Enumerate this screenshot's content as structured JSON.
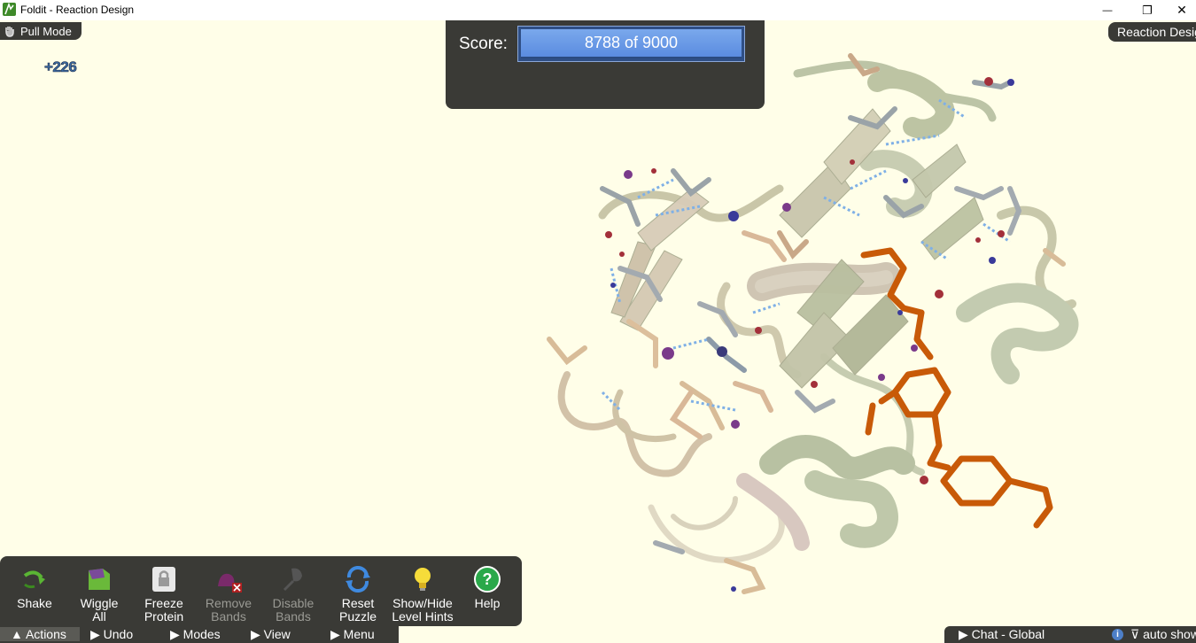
{
  "window": {
    "title": "Foldit - Reaction Design",
    "minimize_symbol": "—",
    "restore_symbol": "❐",
    "close_symbol": "✕"
  },
  "mode": {
    "label": "Pull Mode",
    "icon": "hand-icon"
  },
  "score_delta": "+226",
  "score": {
    "label": "Score:",
    "value": "8788 of 9000"
  },
  "panel_tab": {
    "label": "Reaction Design"
  },
  "toolbar": {
    "tools": [
      {
        "line1": "Shake",
        "line2": "",
        "icon": "shake-icon",
        "enabled": true
      },
      {
        "line1": "Wiggle",
        "line2": "All",
        "icon": "wiggle-icon",
        "enabled": true
      },
      {
        "line1": "Freeze",
        "line2": "Protein",
        "icon": "lock-icon",
        "enabled": true
      },
      {
        "line1": "Remove",
        "line2": "Bands",
        "icon": "remove-bands-icon",
        "enabled": false
      },
      {
        "line1": "Disable",
        "line2": "Bands",
        "icon": "disable-bands-icon",
        "enabled": false
      },
      {
        "line1": "Reset",
        "line2": "Puzzle",
        "icon": "reset-icon",
        "enabled": true
      },
      {
        "line1": "Show/Hide",
        "line2": "Level Hints",
        "icon": "lightbulb-icon",
        "enabled": true
      },
      {
        "line1": "Help",
        "line2": "",
        "icon": "help-icon",
        "enabled": true
      }
    ]
  },
  "bottom_menu": [
    {
      "label": "▲  Actions",
      "active": true
    },
    {
      "label": "▶  Undo",
      "active": false
    },
    {
      "label": "▶  Modes",
      "active": false
    },
    {
      "label": "▶  View",
      "active": false
    },
    {
      "label": "▶  Menu",
      "active": false
    }
  ],
  "chat": {
    "label": "▶  Chat - Global",
    "info": "i",
    "auto": "⊽ auto show"
  },
  "colors": {
    "background": "#fffee8",
    "panel": "#3a3a36",
    "ligand": "#c85a08",
    "score_fill": "#6a9ae6"
  }
}
